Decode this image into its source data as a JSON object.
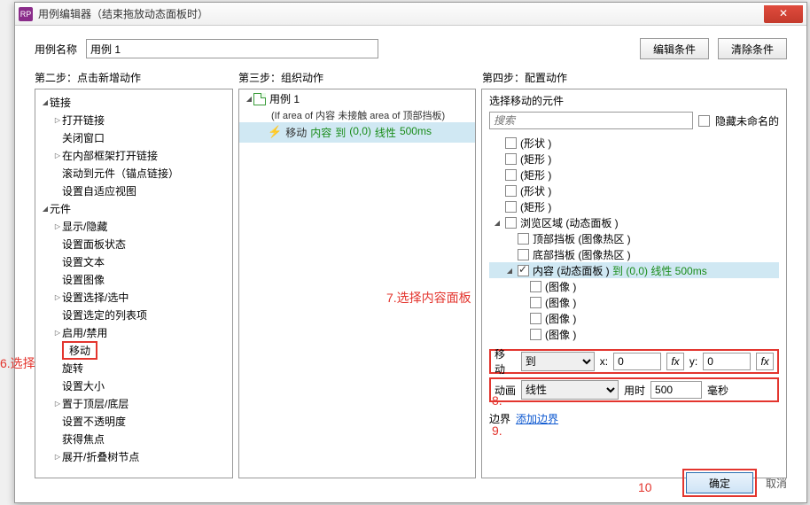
{
  "window": {
    "title": "用例编辑器（结束拖放动态面板时）",
    "app_icon": "RP",
    "close": "✕"
  },
  "labels": {
    "case_name": "用例名称",
    "edit_cond": "编辑条件",
    "clear_cond": "清除条件"
  },
  "case_name_value": "用例 1",
  "steps": {
    "s2": "第二步：点击新增动作",
    "s3": "第三步：组织动作",
    "s4": "第四步：配置动作"
  },
  "actions_tree": {
    "g_links": "链接",
    "open_link": "打开链接",
    "close_win": "关闭窗口",
    "open_inline": "在内部框架打开链接",
    "scroll_to": "滚动到元件（锚点链接）",
    "set_adaptive": "设置自适应视图",
    "g_elements": "元件",
    "show_hide": "显示/隐藏",
    "panel_state": "设置面板状态",
    "set_text": "设置文本",
    "set_image": "设置图像",
    "set_select": "设置选择/选中",
    "set_list": "设置选定的列表项",
    "enable_disable": "启用/禁用",
    "move": "移动",
    "rotate": "旋转",
    "set_size": "设置大小",
    "bring_order": "置于顶层/底层",
    "set_opacity": "设置不透明度",
    "focus": "获得焦点",
    "expand_tree": "展开/折叠树节点"
  },
  "org": {
    "case_label": "用例 1",
    "condition": "(If area of 内容 未接触  area of 顶部挡板)",
    "action": {
      "a1": "移动",
      "a2": "内容",
      "a3": "到",
      "a4": "(0,0)",
      "a5": "线性",
      "a6": "500ms"
    }
  },
  "config": {
    "title": "选择移动的元件",
    "search_ph": "搜索",
    "hide_unnamed": "隐藏未命名的",
    "tree": {
      "shape1": "(形状 )",
      "rect1": "(矩形 )",
      "rect2": "(矩形 )",
      "shape2": "(形状 )",
      "rect3": "(矩形 )",
      "browse": "浏览区域 (动态面板 )",
      "top_block": "顶部挡板 (图像热区 )",
      "bot_block": "底部挡板 (图像热区 )",
      "content_full": {
        "p1": "内容 (动态面板 ) ",
        "p2": "到 (0,0)  线性  500ms"
      },
      "img": "(图像 )"
    },
    "row1": {
      "label": "移动",
      "mode": "到",
      "xl": "x:",
      "xv": "0",
      "yl": "y:",
      "yv": "0",
      "fx": "fx"
    },
    "row2": {
      "label": "动画",
      "mode": "线性",
      "durl": "用时",
      "durv": "500",
      "unit": "毫秒"
    },
    "row3": {
      "label": "边界",
      "link": "添加边界"
    }
  },
  "buttons": {
    "ok": "确定",
    "cancel": "取消"
  },
  "ann": {
    "a6": "6.选择",
    "a7": "7.选择内容面板",
    "a8": "8.",
    "a9": "9.",
    "a10": "10"
  }
}
